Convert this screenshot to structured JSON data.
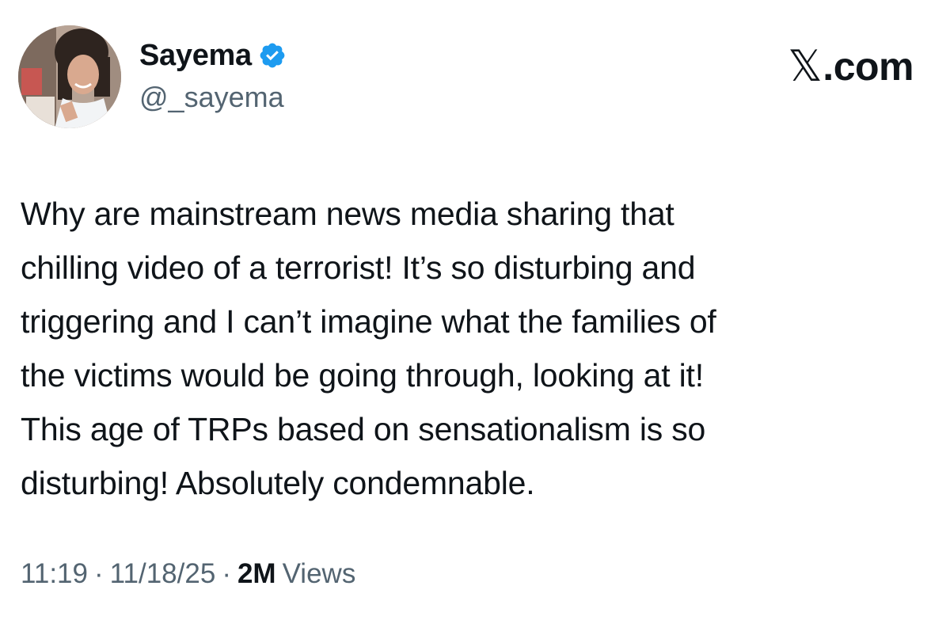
{
  "author": {
    "display_name": "Sayema",
    "handle": "@_sayema",
    "verified": true
  },
  "brand": {
    "x_glyph": "𝕏",
    "suffix": ".com"
  },
  "tweet": {
    "lines": [
      "Why are mainstream news media sharing that",
      "chilling video of a terrorist! It’s so disturbing and",
      "triggering and I can’t imagine what the families of",
      "the victims would be going through, looking at it!",
      "This age of TRPs based on sensationalism is so",
      "disturbing! Absolutely condemnable."
    ]
  },
  "meta": {
    "time": "11:19",
    "separator": "·",
    "date": "11/18/25",
    "views_count": "2M",
    "views_label": "Views"
  },
  "icons": {
    "verified": "verified-badge-icon",
    "avatar": "profile-photo"
  },
  "colors": {
    "text_primary": "#0f1419",
    "text_secondary": "#536471",
    "verified_blue": "#1d9bf0",
    "background": "#ffffff"
  }
}
